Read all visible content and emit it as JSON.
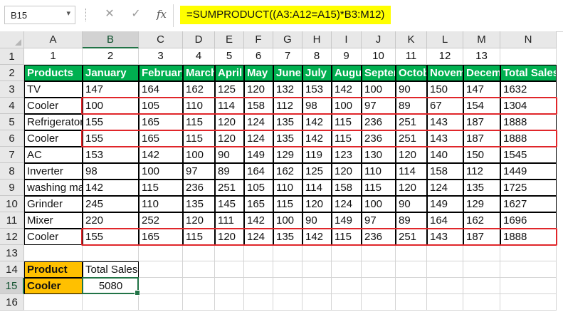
{
  "formula_bar": {
    "name_box": "B15",
    "cancel_icon": "✕",
    "enter_icon": "✓",
    "fx_icon": "fx",
    "formula": "=SUMPRODUCT((A3:A12=A15)*B3:M12)",
    "formula_highlight": "#ffff00"
  },
  "column_headers": [
    "A",
    "B",
    "C",
    "D",
    "E",
    "F",
    "G",
    "H",
    "I",
    "J",
    "K",
    "L",
    "M",
    "N"
  ],
  "row_headers": [
    "1",
    "2",
    "3",
    "4",
    "5",
    "6",
    "7",
    "8",
    "9",
    "10",
    "11",
    "12",
    "13",
    "14",
    "15",
    "16"
  ],
  "rows": {
    "r1": [
      "1",
      "2",
      "3",
      "4",
      "5",
      "6",
      "7",
      "8",
      "9",
      "10",
      "11",
      "12",
      "13",
      ""
    ],
    "r2": [
      "Products",
      "January",
      "February",
      "March",
      "April",
      "May",
      "June",
      "July",
      "August",
      "September",
      "October",
      "November",
      "December",
      "Total Sales"
    ],
    "r3": [
      "TV",
      "147",
      "164",
      "162",
      "125",
      "120",
      "132",
      "153",
      "142",
      "100",
      "90",
      "150",
      "147",
      "1632"
    ],
    "r4": [
      "Cooler",
      "100",
      "105",
      "110",
      "114",
      "158",
      "112",
      "98",
      "100",
      "97",
      "89",
      "67",
      "154",
      "1304"
    ],
    "r5": [
      "Refrigerator",
      "155",
      "165",
      "115",
      "120",
      "124",
      "135",
      "142",
      "115",
      "236",
      "251",
      "143",
      "187",
      "1888"
    ],
    "r6": [
      "Cooler",
      "155",
      "165",
      "115",
      "120",
      "124",
      "135",
      "142",
      "115",
      "236",
      "251",
      "143",
      "187",
      "1888"
    ],
    "r7": [
      "AC",
      "153",
      "142",
      "100",
      "90",
      "149",
      "129",
      "119",
      "123",
      "130",
      "120",
      "140",
      "150",
      "1545"
    ],
    "r8": [
      "Inverter",
      "98",
      "100",
      "97",
      "89",
      "164",
      "162",
      "125",
      "120",
      "110",
      "114",
      "158",
      "112",
      "1449"
    ],
    "r9": [
      "washing machine",
      "142",
      "115",
      "236",
      "251",
      "105",
      "110",
      "114",
      "158",
      "115",
      "120",
      "124",
      "135",
      "1725"
    ],
    "r10": [
      "Grinder",
      "245",
      "110",
      "135",
      "145",
      "165",
      "115",
      "120",
      "124",
      "100",
      "90",
      "149",
      "129",
      "1627"
    ],
    "r11": [
      "Mixer",
      "220",
      "252",
      "120",
      "111",
      "142",
      "100",
      "90",
      "149",
      "97",
      "89",
      "164",
      "162",
      "1696"
    ],
    "r12": [
      "Cooler",
      "155",
      "165",
      "115",
      "120",
      "124",
      "135",
      "142",
      "115",
      "236",
      "251",
      "143",
      "187",
      "1888"
    ],
    "r13": [
      "",
      "",
      "",
      "",
      "",
      "",
      "",
      "",
      "",
      "",
      "",
      "",
      "",
      ""
    ],
    "r14": [
      "Product",
      "Total Sales",
      "",
      "",
      "",
      "",
      "",
      "",
      "",
      "",
      "",
      "",
      "",
      ""
    ],
    "r15": [
      "Cooler",
      "5080",
      "",
      "",
      "",
      "",
      "",
      "",
      "",
      "",
      "",
      "",
      "",
      ""
    ],
    "r16": [
      "",
      "",
      "",
      "",
      "",
      "",
      "",
      "",
      "",
      "",
      "",
      "",
      "",
      ""
    ]
  },
  "colors": {
    "header_fill": "#00b050",
    "lookup_fill": "#ffc000",
    "match_outline": "#e0262a",
    "selection": "#217346"
  },
  "active_cell": "B15",
  "highlighted_rows": [
    "4",
    "6",
    "12"
  ]
}
